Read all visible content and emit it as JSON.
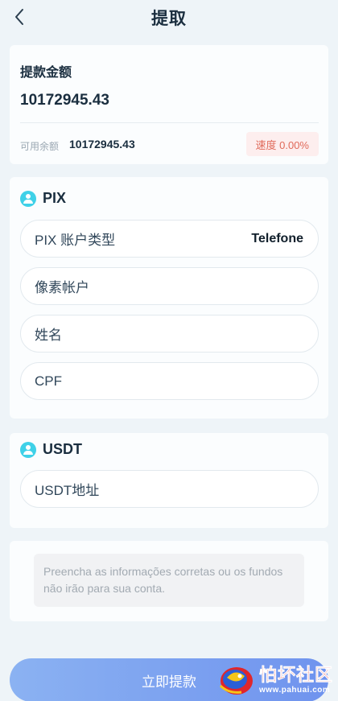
{
  "header": {
    "title": "提取"
  },
  "withdraw": {
    "amount_label": "提款金额",
    "amount_value": "10172945.43",
    "available_label": "可用余额",
    "available_value": "10172945.43",
    "rate_label": "速度 0.00%"
  },
  "pix": {
    "title": "PIX",
    "account_type_label": "PIX 账户类型",
    "account_type_value": "Telefone",
    "pixel_account_placeholder": "像素帐户",
    "name_placeholder": "姓名",
    "cpf_placeholder": "CPF"
  },
  "usdt": {
    "title": "USDT",
    "address_placeholder": "USDT地址"
  },
  "notice": {
    "text": "Preencha as informações corretas ou os fundos não irão para sua conta."
  },
  "submit": {
    "label": "立即提款"
  },
  "watermark": {
    "main": "怕坏社区",
    "sub": "www.pahuai.com"
  },
  "colors": {
    "accent": "#3fd1e8",
    "button": "#7ba2f0",
    "rate_text": "#e06a5a",
    "rate_bg": "#fdeeee"
  }
}
